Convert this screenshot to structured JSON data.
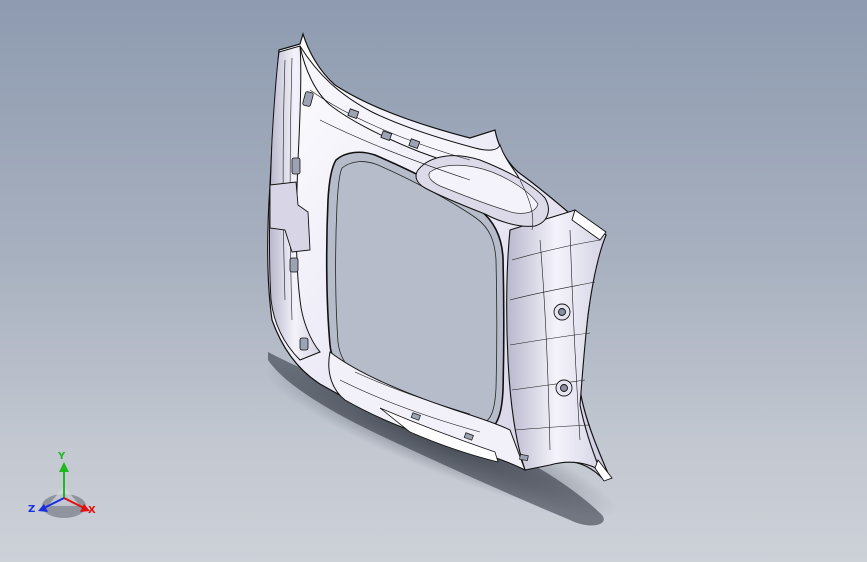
{
  "viewport": {
    "background_top": "#8e9bb0",
    "background_bottom": "#cdd1d8"
  },
  "model": {
    "part_icon": "car-pillar-trim-panel",
    "surface_color": "#eceaf6",
    "edge_color": "#111111",
    "shadow_color": "#2a2f3a"
  },
  "triad": {
    "x_label": "X",
    "y_label": "Y",
    "z_label": "Z",
    "x_color": "#e01010",
    "y_color": "#1fb81f",
    "z_color": "#1830e0"
  }
}
